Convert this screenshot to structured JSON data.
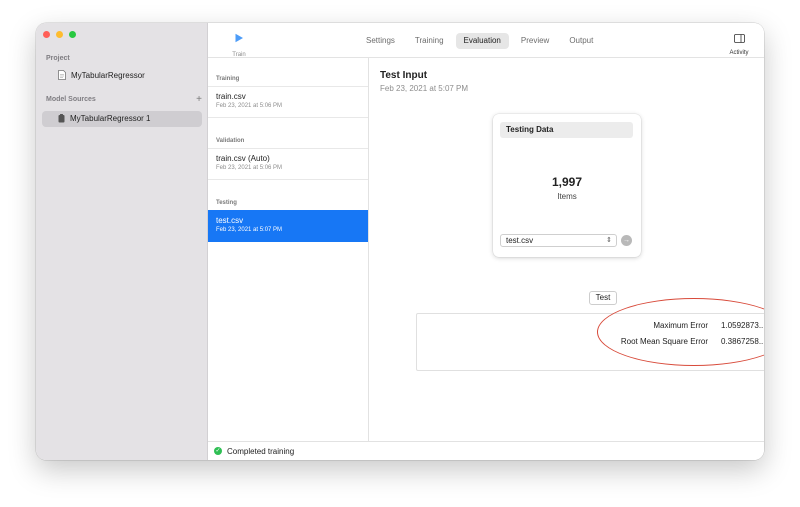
{
  "sidebar": {
    "project_label": "Project",
    "project_name": "MyTabularRegressor",
    "model_sources_label": "Model Sources",
    "add_symbol": "+",
    "model_source_item": "MyTabularRegressor 1"
  },
  "toolbar": {
    "train_label": "Train",
    "tabs": [
      "Settings",
      "Training",
      "Evaluation",
      "Preview",
      "Output"
    ],
    "active_tab": "Evaluation",
    "activity_label": "Activity"
  },
  "data_sources": {
    "training": {
      "section": "Training",
      "name": "train.csv",
      "date": "Feb 23, 2021 at 5:06 PM"
    },
    "validation": {
      "section": "Validation",
      "name": "train.csv (Auto)",
      "date": "Feb 23, 2021 at 5:06 PM"
    },
    "testing": {
      "section": "Testing",
      "name": "test.csv",
      "date": "Feb 23, 2021 at 5:07 PM"
    }
  },
  "main": {
    "title": "Test Input",
    "date": "Feb 23, 2021 at 5:07 PM",
    "card": {
      "header": "Testing Data",
      "count": "1,997",
      "count_label": "Items",
      "file": "test.csv"
    },
    "test_button": "Test",
    "metrics": [
      {
        "name": "Maximum Error",
        "value": "1.0592873..."
      },
      {
        "name": "Root Mean Square Error",
        "value": "0.3867258..."
      }
    ]
  },
  "status": {
    "text": "Completed training"
  },
  "colors": {
    "accent": "#1777f5",
    "annotation": "#d84a3a",
    "success": "#2fbf54",
    "close": "#ff5f57",
    "minimize": "#febc2e",
    "zoom": "#28c840"
  }
}
